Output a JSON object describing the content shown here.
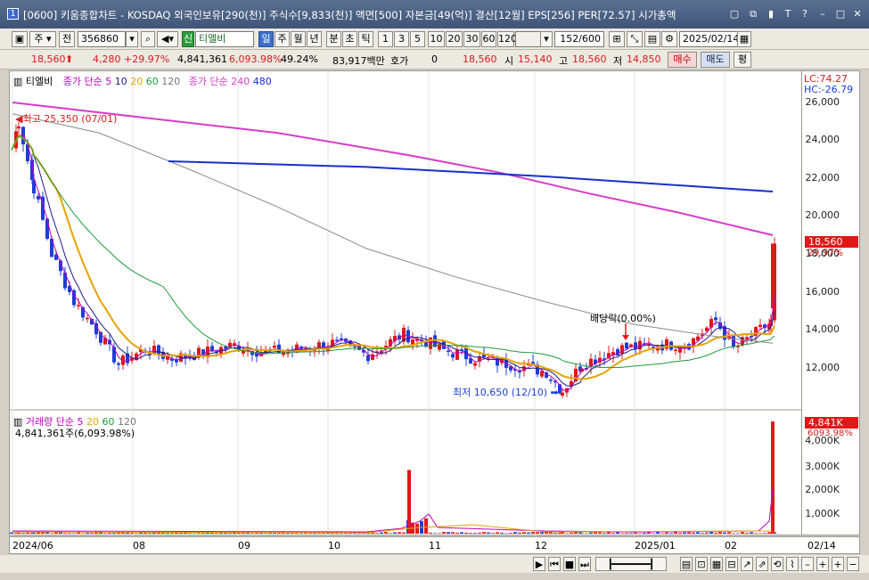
{
  "titlebar": {
    "app_num": "1",
    "title": "[0600] 키움종합차트 - KOSDAQ 외국인보유[290(천)] 주식수[9,833(천)] 액면[500] 자본금[49(억)] 결산[12월] EPS[256] PER[72.57] 시가총액"
  },
  "toolbar": {
    "period_day": "주",
    "prev_label": "전",
    "code": "356860",
    "stock_name": "티엘비",
    "tab_day": "일",
    "tab_week": "주",
    "tab_month": "월",
    "tab_year": "년",
    "tab_min": "분",
    "tab_sec": "초",
    "tab_tick": "틱",
    "intervals": [
      "1",
      "3",
      "5",
      "10",
      "20",
      "30",
      "60",
      "120"
    ],
    "count": "152",
    "count_total": "/600",
    "date": "2025/02/14"
  },
  "infobar": {
    "price": "18,560",
    "change": "4,280",
    "change_pct": "+29.97%",
    "volume": "4,841,361",
    "vol_ratio": "6,093.98%",
    "turnover": "49.24%",
    "amount": "83,917백만",
    "quote_label": "호가",
    "quote_value": "0",
    "ask": "18,560",
    "open_label": "시",
    "open": "15,140",
    "high_label": "고",
    "high": "18,560",
    "low_label": "저",
    "low": "14,850",
    "buy_label": "매수",
    "sell_label": "매도",
    "flat_label": "평"
  },
  "price_panel": {
    "name_label": "티엘비",
    "legend_prefix": "종가 단순",
    "ma_periods": [
      "5",
      "10",
      "20",
      "60",
      "120"
    ],
    "legend_prefix2": "종가 단순",
    "ma_long": [
      "240",
      "480"
    ],
    "high_note": "최고 25,350 (07/01)",
    "low_note": "최저 10,650 (12/10)",
    "dividend_note": "배당락(0.00%)",
    "lc": "LC:74.27",
    "hc": "HC:-26.79",
    "last_price": "18,560",
    "last_pct": "29.97%",
    "y_ticks": [
      "26,000",
      "24,000",
      "22,000",
      "20,000",
      "18,000",
      "16,000",
      "14,000",
      "12,000"
    ]
  },
  "volume_panel": {
    "legend": "거래량 단순",
    "ma_periods": [
      "5",
      "20",
      "60",
      "120"
    ],
    "value": "4,841,361주(6,093.98%)",
    "last_vol": "4,841K",
    "last_pct": "6093.98%",
    "y_ticks": [
      "4,000K",
      "3,000K",
      "2,000K",
      "1,000K"
    ]
  },
  "x_axis": {
    "labels": [
      "2024/06",
      "08",
      "09",
      "10",
      "11",
      "12",
      "2025/01",
      "02",
      "02/14"
    ]
  },
  "colors": {
    "up": "#e01818",
    "down": "#1c3dd8",
    "ma5": "#c000c0",
    "ma10": "#1c1c8c",
    "ma20": "#e6a400",
    "ma60": "#1f9a3a",
    "ma120": "#8a8a8a",
    "ma240": "#d83cc8",
    "ma480": "#1a2ed0"
  }
}
